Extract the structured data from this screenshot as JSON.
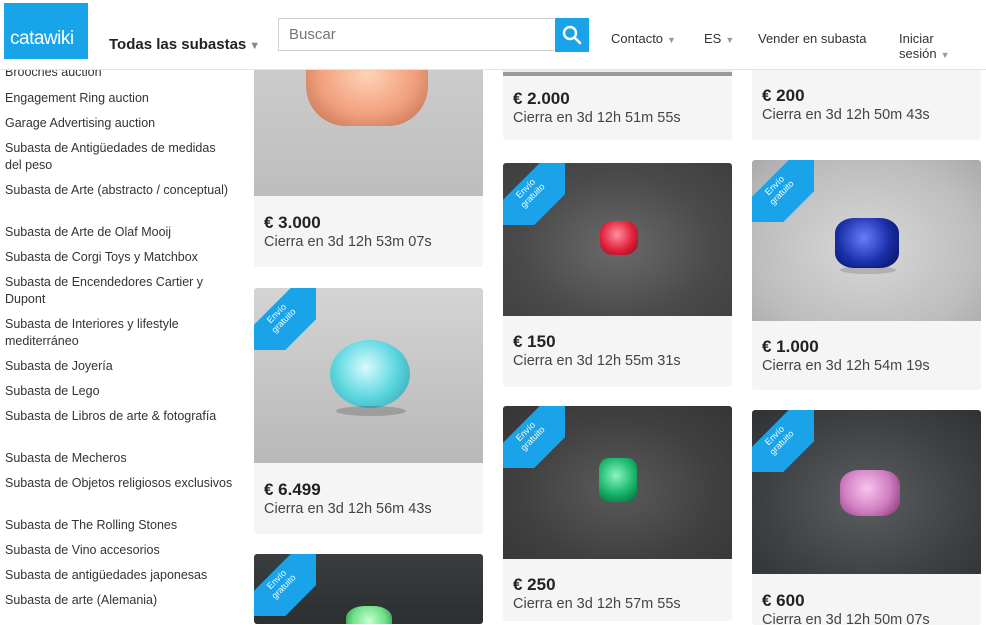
{
  "header": {
    "logo_text": "catawiki",
    "all_auctions": "Todas las subastas",
    "search_placeholder": "Buscar",
    "nav": {
      "contact": "Contacto",
      "language": "ES",
      "sell": "Vender en subasta",
      "login": "Iniciar sesión"
    }
  },
  "sidebar": {
    "items": [
      "Brooches auction",
      "Engagement Ring auction",
      "Garage Advertising auction",
      "Subasta de Antigüedades de medidas del peso",
      "Subasta de Arte (abstracto / conceptual)",
      "Subasta de Arte de Olaf Mooij",
      "Subasta de Corgi Toys y Matchbox",
      "Subasta de Encendedores Cartier y Dupont",
      "Subasta de Interiores y lifestyle mediterráneo",
      "Subasta de Joyería",
      "Subasta de Lego",
      "Subasta de Libros de arte & fotografía",
      "Subasta de Mecheros",
      "Subasta de Objetos religiosos exclusivos",
      "Subasta de The Rolling Stones",
      "Subasta de Vino accesorios",
      "Subasta de antigüedades japonesas",
      "Subasta de arte (Alemania)"
    ]
  },
  "ribbon": {
    "line1": "Envío",
    "line2": "gratuito"
  },
  "cards": [
    {
      "price": "€ 3.000",
      "closes": "Cierra en 3d 12h 53m 07s",
      "gem_color": "#f2a07d"
    },
    {
      "price": "€ 6.499",
      "closes": "Cierra en 3d 12h 56m 43s",
      "gem_color": "#5fd8e0"
    },
    {
      "price": "€ 2.000",
      "closes": "Cierra en 3d 12h 51m 55s"
    },
    {
      "price": "€ 150",
      "closes": "Cierra en 3d 12h 55m 31s",
      "gem_color": "#e0203a"
    },
    {
      "price": "€ 250",
      "closes": "Cierra en 3d 12h 57m 55s",
      "gem_color": "#18b56a"
    },
    {
      "price": "€ 200",
      "closes": "Cierra en 3d 12h 50m 43s"
    },
    {
      "price": "€ 1.000",
      "closes": "Cierra en 3d 12h 54m 19s",
      "gem_color": "#1a2fa8"
    },
    {
      "price": "€ 600",
      "closes": "Cierra en 3d 12h 50m 07s",
      "gem_color": "#d07cc0"
    }
  ],
  "partial_card_gem_color": "#6fe08a",
  "colors": {
    "brand": "#1aa3e8"
  }
}
